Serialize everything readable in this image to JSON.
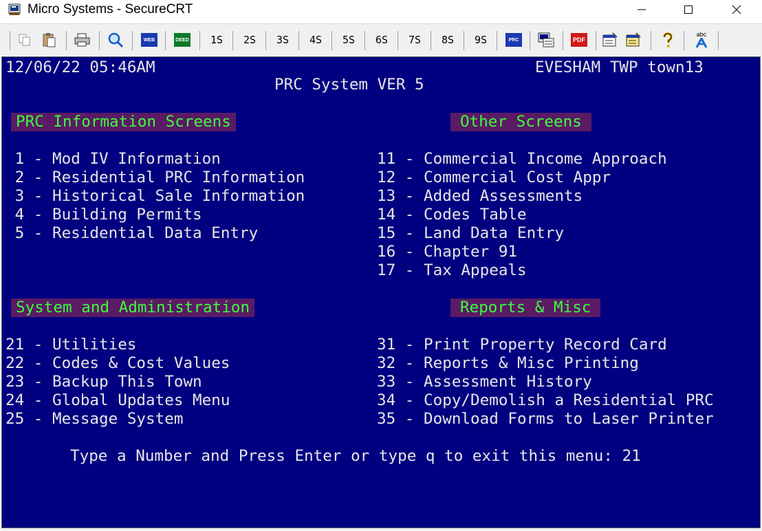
{
  "window": {
    "title": "Micro Systems - SecureCRT"
  },
  "toolbar": {
    "tab_buttons": [
      "1S",
      "2S",
      "3S",
      "4S",
      "5S",
      "6S",
      "7S",
      "8S",
      "9S"
    ],
    "web_label": "WEB",
    "deed_label": "DEED",
    "prc_label": "PRC",
    "pdf_label": "PDF",
    "abc_label": "abc"
  },
  "terminal": {
    "datetime": "12/06/22 05:46AM",
    "location": "EVESHAM TWP town13",
    "system_title": "PRC System VER 5",
    "sections": {
      "prc_info": "PRC Information Screens",
      "other": "Other Screens",
      "system_admin": "System and Administration",
      "reports": "Reports & Misc"
    },
    "prc_info_items": [
      " 1 - Mod IV Information",
      " 2 - Residential PRC Information",
      " 3 - Historical Sale Information",
      " 4 - Building Permits",
      " 5 - Residential Data Entry"
    ],
    "other_items": [
      "11 - Commercial Income Approach",
      "12 - Commercial Cost Appr",
      "13 - Added Assessments",
      "14 - Codes Table",
      "15 - Land Data Entry",
      "16 - Chapter 91",
      "17 - Tax Appeals"
    ],
    "admin_items": [
      "21 - Utilities",
      "22 - Codes & Cost Values",
      "23 - Backup This Town",
      "24 - Global Updates Menu",
      "25 - Message System"
    ],
    "report_items": [
      "31 - Print Property Record Card",
      "32 - Reports & Misc Printing",
      "33 - Assessment History",
      "34 - Copy/Demolish a Residential PRC",
      "35 - Download Forms to Laser Printer"
    ],
    "prompt": "Type a Number and Press Enter or type q to exit this menu: ",
    "input_value": "21"
  }
}
